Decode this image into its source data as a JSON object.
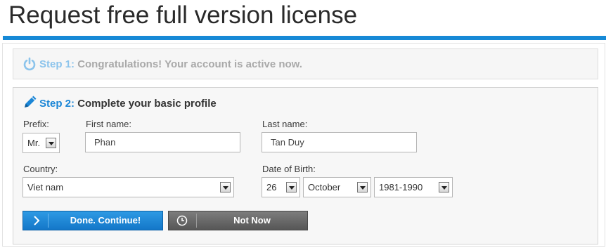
{
  "page": {
    "title": "Request free full version license"
  },
  "step1": {
    "number": "Step 1:",
    "text": "Congratulations! Your account is active now."
  },
  "step2": {
    "number": "Step 2:",
    "text": "Complete your basic profile"
  },
  "form": {
    "prefix": {
      "label": "Prefix:",
      "value": "Mr."
    },
    "first_name": {
      "label": "First name:",
      "value": "Phan"
    },
    "last_name": {
      "label": "Last name:",
      "value": "Tan Duy"
    },
    "country": {
      "label": "Country:",
      "value": "Viet nam"
    },
    "dob": {
      "label": "Date of Birth:",
      "day": "26",
      "month": "October",
      "year": "1981-1990"
    }
  },
  "buttons": {
    "done": "Done. Continue!",
    "not_now": "Not Now"
  },
  "colors": {
    "accent": "#1689d6",
    "done_button": "#1b86d6",
    "not_now_button": "#666666"
  },
  "icons": {
    "step1": "power-icon",
    "step2": "pencil-icon",
    "done": "chevron-right-icon",
    "not_now": "clock-icon"
  }
}
